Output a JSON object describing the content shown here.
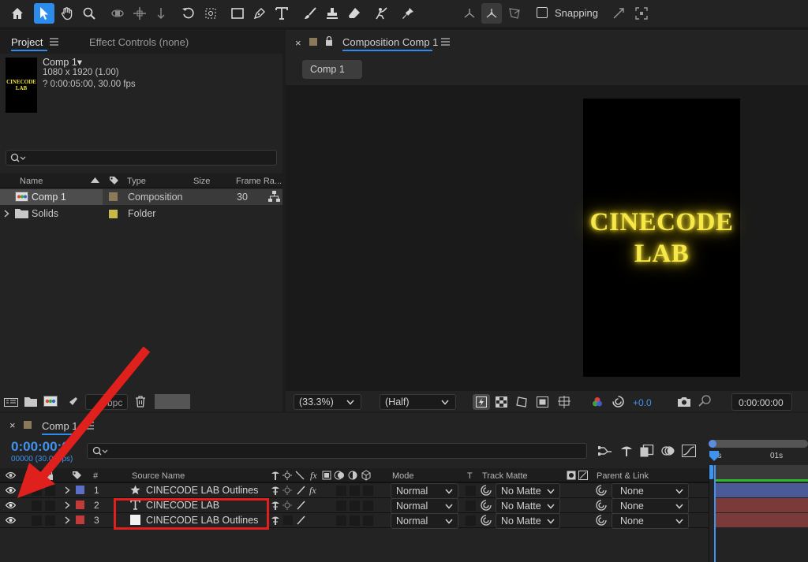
{
  "toolbar": {
    "snapping_label": "Snapping"
  },
  "project_panel": {
    "tab_project": "Project",
    "tab_effect_controls": "Effect Controls (none)",
    "comp_name": "Comp 1▾",
    "comp_dims": "1080 x 1920 (1.00)",
    "comp_duration": "? 0:00:05:00, 30.00 fps",
    "thumb_text_line1": "CINECODE",
    "thumb_text_line2": "LAB",
    "search_placeholder": "",
    "columns": {
      "name": "Name",
      "type": "Type",
      "size": "Size",
      "frame_rate": "Frame Ra..."
    },
    "items": [
      {
        "name": "Comp 1",
        "type": "Composition",
        "size": "",
        "frame_rate": "30",
        "label_color": "#8a7a5a",
        "selected": true
      },
      {
        "name": "Solids",
        "type": "Folder",
        "size": "",
        "frame_rate": "",
        "label_color": "#c8b74a",
        "selected": false
      }
    ],
    "bpc_label": "bpc"
  },
  "comp_panel": {
    "tab_title": "Composition Comp 1",
    "breadcrumb": "Comp 1",
    "canvas_line1": "CINECODE",
    "canvas_line2": "LAB",
    "zoom": "(33.3%)",
    "resolution": "(Half)",
    "exposure": "+0.0",
    "timecode": "0:00:00:00"
  },
  "timeline": {
    "tab_title": "Comp 1",
    "timecode": "0:00:00:0",
    "frame_info": "00000 (30.00 fps)",
    "search_placeholder": "",
    "col_num": "#",
    "col_source": "Source Name",
    "col_mode": "Mode",
    "col_t": "T",
    "col_track_matte": "Track Matte",
    "col_parent": "Parent & Link",
    "ruler_0": "0s",
    "ruler_1": "01s",
    "layers": [
      {
        "num": "1",
        "name": "CINECODE LAB Outlines",
        "icon": "star-icon",
        "label_color": "#5b6fc9",
        "mode": "Normal",
        "matte": "No Matte",
        "parent": "None",
        "bar_color": "#4b5a96"
      },
      {
        "num": "2",
        "name": "CINECODE LAB",
        "icon": "text-layer-icon",
        "label_color": "#c23b3b",
        "mode": "Normal",
        "matte": "No Matte",
        "parent": "None",
        "bar_color": "#7a3a3a"
      },
      {
        "num": "3",
        "name": "CINECODE LAB Outlines",
        "icon": "solid-layer-icon",
        "label_color": "#c23b3b",
        "mode": "Normal",
        "matte": "No Matte",
        "parent": "None",
        "bar_color": "#7a3a3a"
      }
    ]
  },
  "colors": {
    "accent_blue": "#2d8ceb",
    "glow_yellow": "#f4e23a",
    "annotation_red": "#e0201d",
    "timecode_blue": "#3f93f0"
  }
}
